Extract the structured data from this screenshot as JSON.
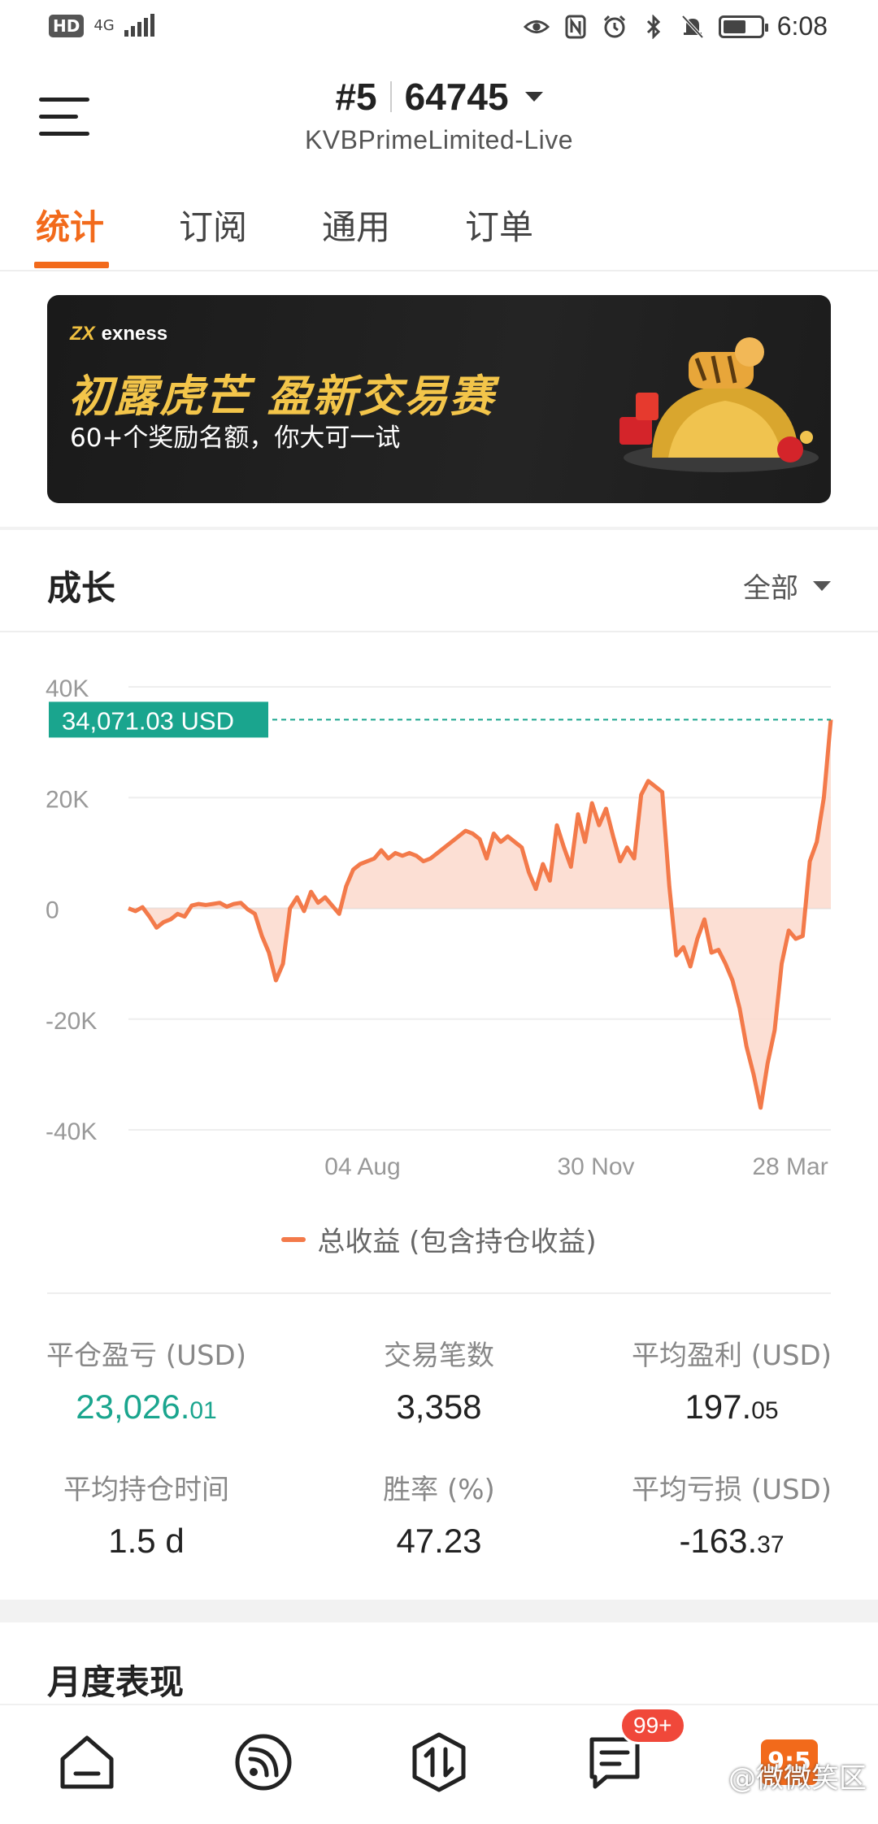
{
  "status_bar": {
    "hd": "HD",
    "network": "4G",
    "time": "6:08"
  },
  "header": {
    "account_number": "#5",
    "account_id": "64745",
    "server": "KVBPrimeLimited-Live"
  },
  "tabs": [
    {
      "label": "统计",
      "active": true
    },
    {
      "label": "订阅",
      "active": false
    },
    {
      "label": "通用",
      "active": false
    },
    {
      "label": "订单",
      "active": false
    }
  ],
  "banner": {
    "brand": "exness",
    "title": "初露虎芒 盈新交易赛",
    "subtitle": "60+个奖励名额，你大可一试"
  },
  "growth": {
    "title": "成长",
    "filter": "全部",
    "current_value_label": "34,071.03 USD",
    "legend": "总收益 (包含持仓收益)"
  },
  "chart_data": {
    "type": "area",
    "ylim": [
      -40000,
      40000
    ],
    "y_ticks": [
      "40K",
      "20K",
      "0",
      "-20K",
      "-40K"
    ],
    "y_tick_values": [
      40000,
      20000,
      0,
      -20000,
      -40000
    ],
    "x_tick_labels": [
      "04 Aug",
      "30 Nov",
      "28 Mar"
    ],
    "current_value": 34071.03,
    "series": [
      {
        "name": "总收益 (包含持仓收益)",
        "color": "#f37a4a",
        "fill": "#fcd9cc",
        "values": [
          0,
          -500,
          200,
          -1500,
          -3500,
          -2500,
          -2000,
          -1000,
          -1500,
          500,
          800,
          600,
          800,
          1000,
          300,
          800,
          1000,
          -200,
          -1000,
          -5000,
          -8000,
          -13000,
          -10000,
          0,
          2000,
          -500,
          3000,
          1000,
          2000,
          500,
          -1000,
          4000,
          7000,
          8000,
          8500,
          9000,
          10500,
          9000,
          10000,
          9500,
          10000,
          9500,
          8500,
          9000,
          10000,
          11000,
          12000,
          13000,
          14000,
          13500,
          12500,
          9000,
          13500,
          12000,
          13000,
          12000,
          11000,
          6500,
          3500,
          8000,
          5000,
          15000,
          11000,
          7500,
          17000,
          12000,
          19000,
          15000,
          18000,
          13000,
          8500,
          11000,
          9000,
          20500,
          23000,
          22000,
          21000,
          4000,
          -8500,
          -7000,
          -10500,
          -5500,
          -2000,
          -8000,
          -7500,
          -10000,
          -13000,
          -18000,
          -25000,
          -30000,
          -36000,
          -28000,
          -22000,
          -10000,
          -4000,
          -5500,
          -5000,
          8500,
          12000,
          20000,
          34071
        ]
      }
    ]
  },
  "stats": [
    {
      "label": "平仓盈亏 (USD)",
      "value_main": "23,026.",
      "value_small": "01",
      "color": "#1aa58e"
    },
    {
      "label": "交易笔数",
      "value_main": "3,358",
      "value_small": ""
    },
    {
      "label": "平均盈利 (USD)",
      "value_main": "197.",
      "value_small": "05"
    },
    {
      "label": "平均持仓时间",
      "value_main": "1.5 d",
      "value_small": ""
    },
    {
      "label": "胜率 (%)",
      "value_main": "47.23",
      "value_small": ""
    },
    {
      "label": "平均亏损 (USD)",
      "value_main": "-163.",
      "value_small": "37"
    }
  ],
  "monthly": {
    "title": "月度表现"
  },
  "bottom_nav": {
    "badge": "99+",
    "promo": "9:5",
    "watermark": "@微微笑区"
  }
}
